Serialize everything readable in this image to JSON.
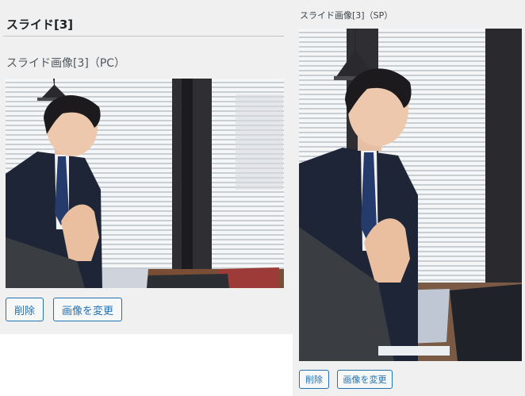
{
  "section": {
    "title": "スライド[3]"
  },
  "pc": {
    "label": "スライド画像[3]（PC）",
    "delete_label": "削除",
    "change_label": "画像を変更"
  },
  "sp": {
    "label": "スライド画像[3]（SP）",
    "delete_label": "削除",
    "change_label": "画像を変更"
  },
  "colors": {
    "background": "#f0f0f1",
    "button_accent": "#2271b1",
    "divider": "#c3c4c7"
  }
}
